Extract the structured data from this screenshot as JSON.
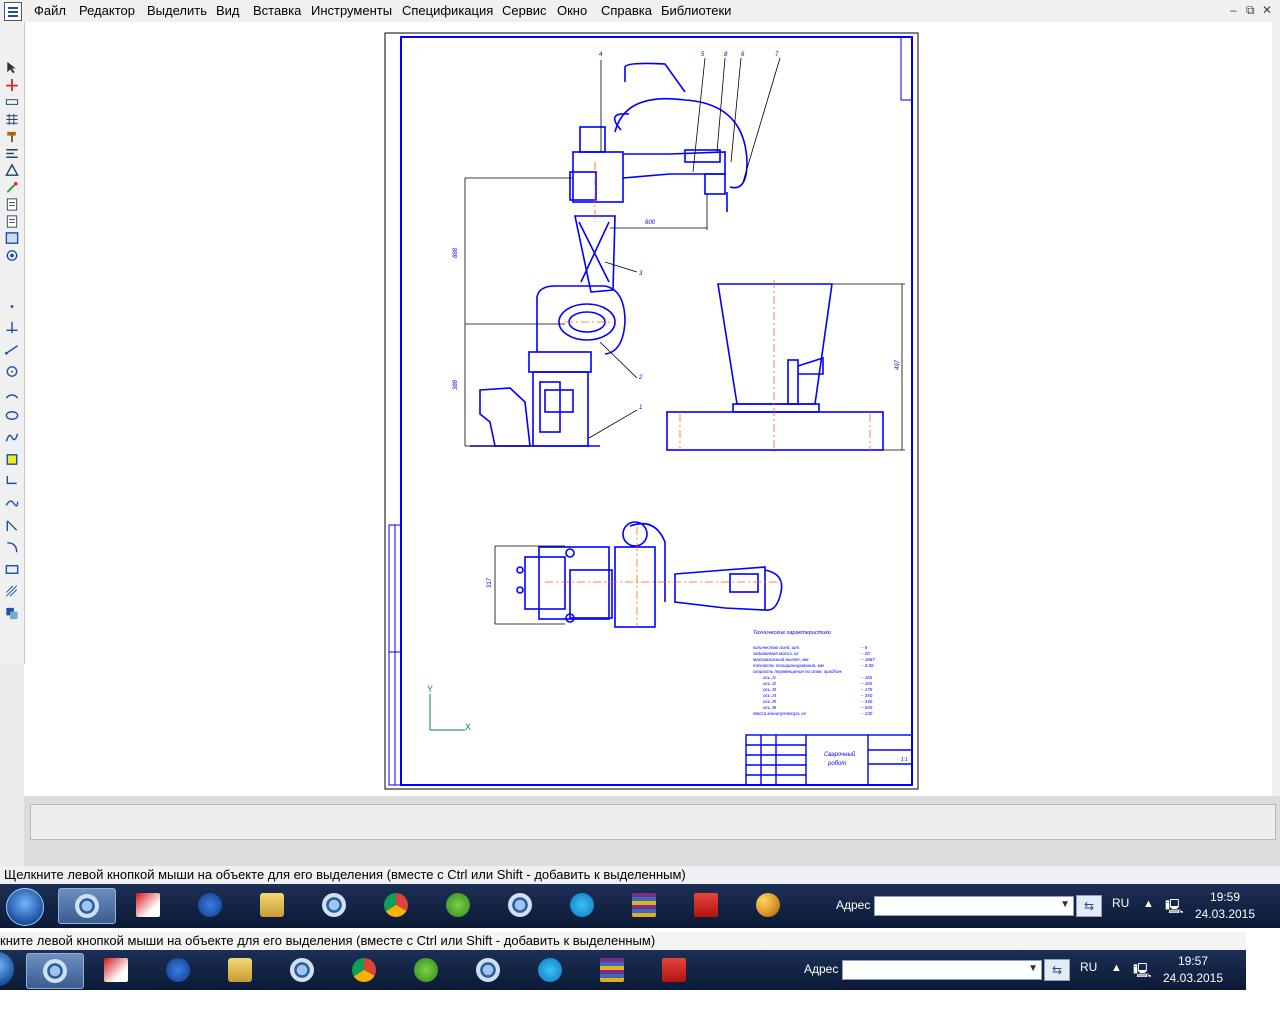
{
  "menu": {
    "items": [
      "Файл",
      "Редактор",
      "Выделить",
      "Вид",
      "Вставка",
      "Инструменты",
      "Спецификация",
      "Сервис",
      "Окно",
      "Справка",
      "Библиотеки"
    ],
    "window_controls": [
      "–",
      "⧉",
      "✕"
    ]
  },
  "toolbar": {
    "icons": [
      "select-arrow-icon",
      "move-icon",
      "measure-icon",
      "grid-icon",
      "hammer-icon",
      "lines-icon",
      "triangle-icon",
      "stamp-icon",
      "doc-icon",
      "doc-icon",
      "frame-icon",
      "view-icon",
      "point-icon",
      "axis-icon",
      "segment-icon",
      "circle-icon",
      "arc-icon",
      "ellipse-icon",
      "spline-icon",
      "hatch-icon",
      "bend-icon",
      "curve-icon",
      "chamfer-icon",
      "fillet-icon",
      "rect-icon",
      "stripes-icon",
      "color-icon"
    ]
  },
  "drawing": {
    "callouts": [
      "4",
      "5",
      "8",
      "6",
      "7",
      "3",
      "2",
      "1"
    ],
    "dim_600": "600",
    "dim_1": "888",
    "dim_2": "388",
    "dim_3": "497",
    "dim_4": "317",
    "tech_title": "Технические характеристики",
    "tech_rows": [
      [
        "количество осей, шт.",
        "– 6"
      ],
      [
        "задаваемая масса, кг",
        "– 20"
      ],
      [
        "максимальный вылет, мм",
        "– 1667"
      ],
      [
        "точность позиционирования, мм",
        "– 0.08"
      ],
      [
        "скорость перемещения по осям, град/сек",
        ""
      ],
      [
        "ось J1",
        "– 165"
      ],
      [
        "ось J2",
        "– 165"
      ],
      [
        "ось J3",
        "– 175"
      ],
      [
        "ось J4",
        "– 350"
      ],
      [
        "ось J5",
        "– 340"
      ],
      [
        "ось J6",
        "– 520"
      ],
      [
        "Масса манипулятора, кг",
        "– 230"
      ]
    ],
    "title_block": {
      "name_line1": "Сварочный",
      "name_line2": "робот",
      "sheet": "1:1"
    },
    "axis_y": "Y",
    "axis_x": "X"
  },
  "status": {
    "hint_top": "Щелкните левой кнопкой мыши на объекте для его выделения (вместе с Ctrl или Shift - добавить к выделенным)",
    "hint_bottom": "кните левой кнопкой мыши на объекте для его выделения (вместе с Ctrl или Shift - добавить к выделенным)"
  },
  "taskbar_top": {
    "address_label": "Адрес",
    "language": "RU",
    "time": "19:59",
    "date": "24.03.2015",
    "apps": [
      "kompas-icon",
      "autocad-icon",
      "flash-icon",
      "explorer-icon",
      "kompas-icon",
      "chrome-icon",
      "utorrent-icon",
      "kompas-icon",
      "skype-icon",
      "winrar-icon",
      "acrobat-icon",
      "paint-icon"
    ]
  },
  "taskbar_bottom": {
    "address_label": "Адрес",
    "language": "RU",
    "time": "19:57",
    "date": "24.03.2015",
    "apps": [
      "kompas-icon",
      "autocad-icon",
      "flash-icon",
      "explorer-icon",
      "kompas-icon",
      "chrome-icon",
      "utorrent-icon",
      "kompas-icon",
      "skype-icon",
      "winrar-icon",
      "acrobat-icon"
    ]
  },
  "colors": {
    "drawing_line": "#0000ff",
    "center_line": "#ff6600",
    "taskbar": "#0c1a36"
  }
}
